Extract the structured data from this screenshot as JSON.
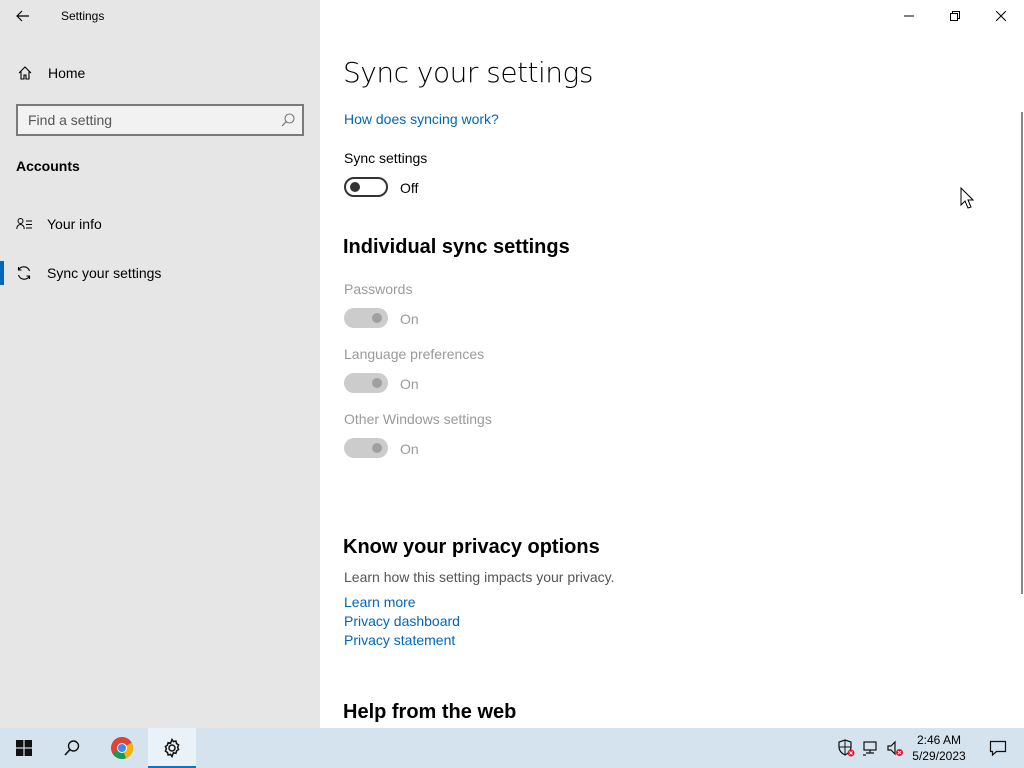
{
  "window": {
    "title": "Settings",
    "controls": {
      "minimize": "minimize-icon",
      "restore": "restore-icon",
      "close": "close-icon"
    }
  },
  "nav": {
    "home_label": "Home",
    "search_placeholder": "Find a setting",
    "section_title": "Accounts",
    "items": [
      {
        "label": "Your info",
        "icon": "person-list-icon",
        "active": false
      },
      {
        "label": "Sync your settings",
        "icon": "sync-icon",
        "active": true
      }
    ]
  },
  "content": {
    "page_title": "Sync your settings",
    "how_link": "How does syncing work?",
    "sync_settings": {
      "label": "Sync settings",
      "state": "Off"
    },
    "individual_title": "Individual sync settings",
    "individual": [
      {
        "label": "Passwords",
        "state": "On"
      },
      {
        "label": "Language preferences",
        "state": "On"
      },
      {
        "label": "Other Windows settings",
        "state": "On"
      }
    ],
    "privacy_title": "Know your privacy options",
    "privacy_text": "Learn how this setting impacts your privacy.",
    "privacy_links": [
      "Learn more",
      "Privacy dashboard",
      "Privacy statement"
    ],
    "help_title": "Help from the web"
  },
  "taskbar": {
    "time": "2:46 AM",
    "date": "5/29/2023",
    "accent": "#0078d4"
  },
  "colors": {
    "link": "#0067b8",
    "nav_bg": "#e6e6e6",
    "taskbar_bg": "#d5e3ef"
  }
}
